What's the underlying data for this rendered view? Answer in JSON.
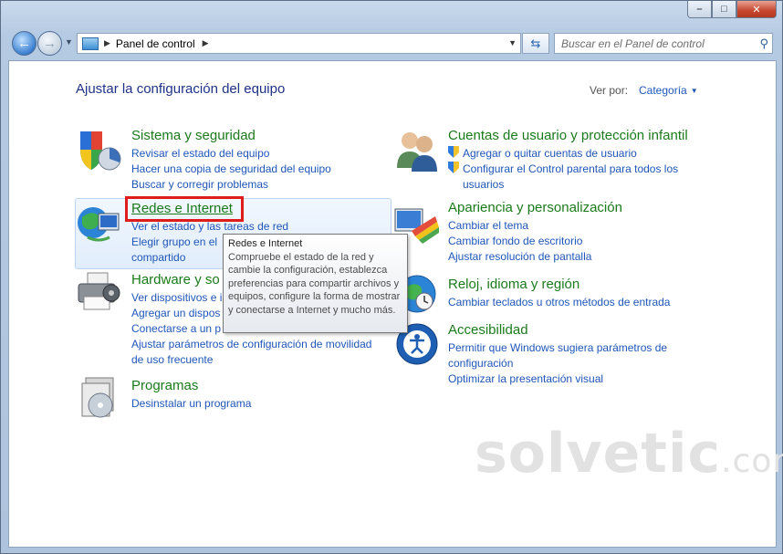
{
  "window": {
    "caption_buttons": [
      "min-icon",
      "max-icon",
      "close-icon"
    ]
  },
  "nav": {
    "address_crumb": "Panel de control",
    "search_placeholder": "Buscar en el Panel de control"
  },
  "header": {
    "title": "Ajustar la configuración del equipo",
    "view_by_label": "Ver por:",
    "view_by_value": "Categoría"
  },
  "categories": {
    "system": {
      "title": "Sistema y seguridad",
      "links": [
        "Revisar el estado del equipo",
        "Hacer una copia de seguridad del equipo",
        "Buscar y corregir problemas"
      ]
    },
    "network": {
      "title": "Redes e Internet",
      "links": [
        "Ver el estado y las tareas de red",
        "Elegir grupo en el",
        "compartido"
      ]
    },
    "hardware": {
      "title": "Hardware y so",
      "links": [
        "Ver dispositivos e i",
        "Agregar un dispos",
        "Conectarse a un p",
        "Ajustar parámetros de configuración de movilidad de uso frecuente"
      ]
    },
    "programs": {
      "title": "Programas",
      "links": [
        "Desinstalar un programa"
      ]
    },
    "accounts": {
      "title": "Cuentas de usuario y protección infantil",
      "links": [
        "Agregar o quitar cuentas de usuario",
        "Configurar el Control parental para todos los usuarios"
      ]
    },
    "appearance": {
      "title": "Apariencia y personalización",
      "links": [
        "Cambiar el tema",
        "Cambiar fondo de escritorio",
        "Ajustar resolución de pantalla"
      ]
    },
    "clock": {
      "title": "Reloj, idioma y región",
      "links": [
        "Cambiar teclados u otros métodos de entrada"
      ]
    },
    "access": {
      "title": "Accesibilidad",
      "links": [
        "Permitir que Windows sugiera parámetros de configuración",
        "Optimizar la presentación visual"
      ]
    }
  },
  "tooltip": {
    "title": "Redes e Internet",
    "body": "Compruebe el estado de la red y cambie la configuración, establezca preferencias para compartir archivos y equipos, configure la forma de mostrar y conectarse a Internet y mucho más."
  },
  "watermark": {
    "text": "solvetic",
    "suffix": ".com"
  }
}
